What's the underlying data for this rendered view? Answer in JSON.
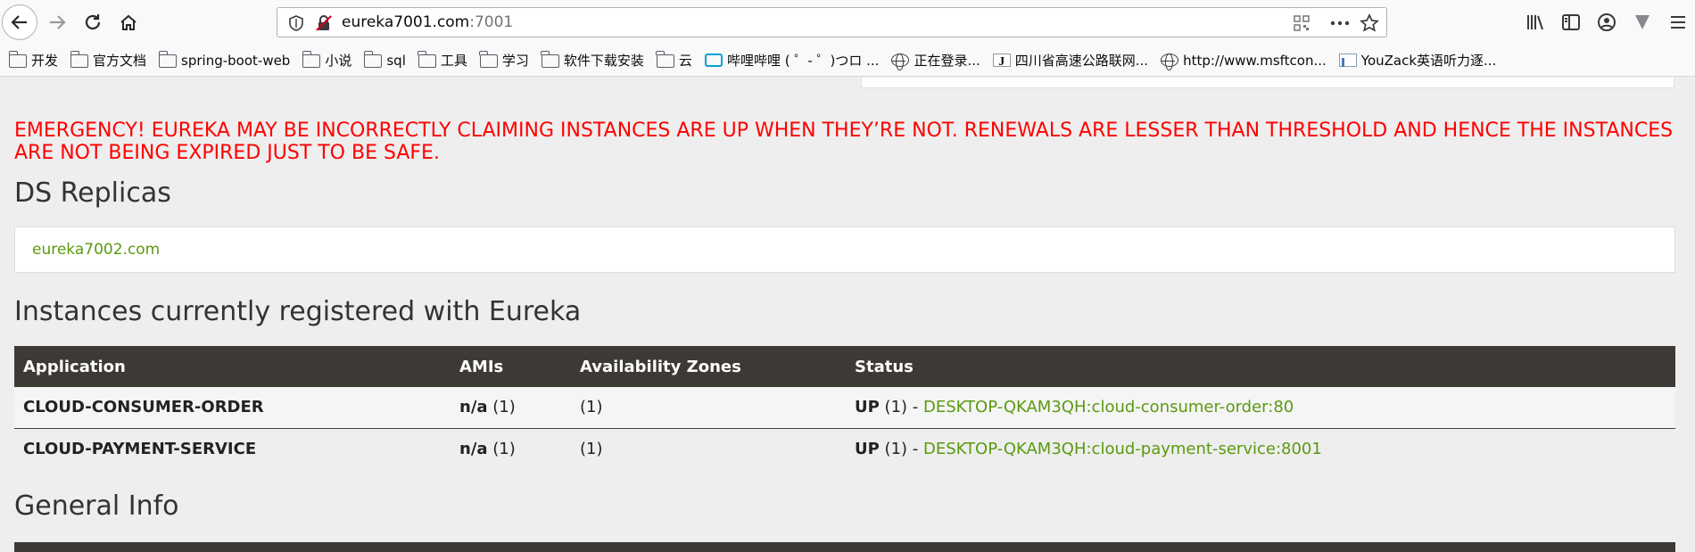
{
  "browser": {
    "url_host": "eureka7001.com",
    "url_port": ":7001",
    "bookmarks": [
      {
        "label": "开发",
        "icon": "folder-icon"
      },
      {
        "label": "官方文档",
        "icon": "folder-icon"
      },
      {
        "label": "spring-boot-web",
        "icon": "folder-icon"
      },
      {
        "label": "小说",
        "icon": "folder-icon"
      },
      {
        "label": "sql",
        "icon": "folder-icon"
      },
      {
        "label": "工具",
        "icon": "folder-icon"
      },
      {
        "label": "学习",
        "icon": "folder-icon"
      },
      {
        "label": "软件下载安装",
        "icon": "folder-icon"
      },
      {
        "label": "云",
        "icon": "folder-icon"
      },
      {
        "label": "哔哩哔哩 ( ゜- ゜)つロ ...",
        "icon": "bilibili-icon"
      },
      {
        "label": "正在登录...",
        "icon": "globe-icon"
      },
      {
        "label": "四川省高速公路联网...",
        "icon": "j-site-icon"
      },
      {
        "label": "http://www.msftcon...",
        "icon": "globe-icon"
      },
      {
        "label": "YouZack英语听力逐...",
        "icon": "document-icon"
      }
    ]
  },
  "page": {
    "emergency": "EMERGENCY! EUREKA MAY BE INCORRECTLY CLAIMING INSTANCES ARE UP WHEN THEY’RE NOT. RENEWALS ARE LESSER THAN THRESHOLD AND HENCE THE INSTANCES ARE NOT BEING EXPIRED JUST TO BE SAFE.",
    "ds_replicas_title": "DS Replicas",
    "replica_link": "eureka7002.com",
    "instances_title": "Instances currently registered with Eureka",
    "table": {
      "headers": [
        "Application",
        "AMIs",
        "Availability Zones",
        "Status"
      ],
      "rows": [
        {
          "application": "CLOUD-CONSUMER-ORDER",
          "ami": "n/a",
          "ami_count": "(1)",
          "zones": "(1)",
          "status": "UP",
          "status_count": "(1) - ",
          "instance": "DESKTOP-QKAM3QH:cloud-consumer-order:80"
        },
        {
          "application": "CLOUD-PAYMENT-SERVICE",
          "ami": "n/a",
          "ami_count": "(1)",
          "zones": "(1)",
          "status": "UP",
          "status_count": "(1) - ",
          "instance": "DESKTOP-QKAM3QH:cloud-payment-service:8001"
        }
      ]
    },
    "general_info_title": "General Info"
  },
  "colors": {
    "emergency": "#ff0000",
    "link": "#5a9a10",
    "table_header": "#3d3a36"
  }
}
